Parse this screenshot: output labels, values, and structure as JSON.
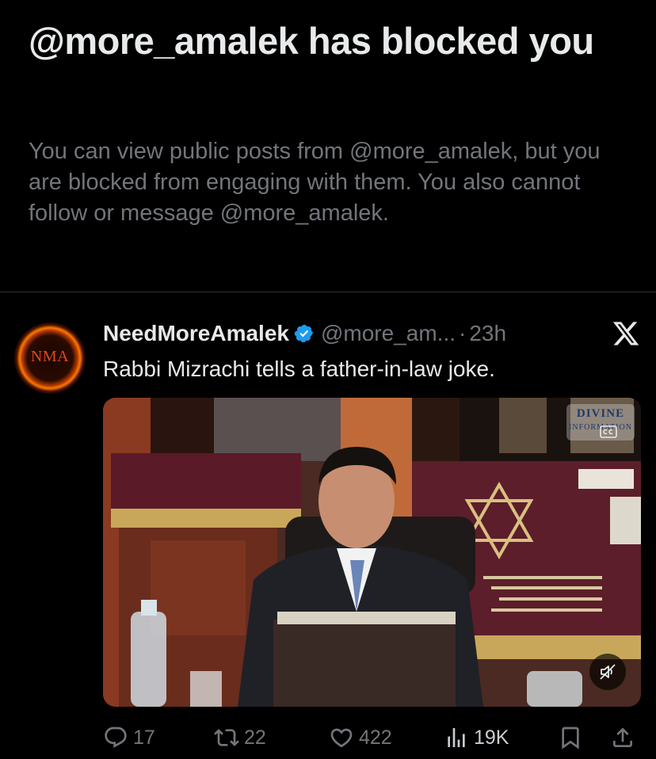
{
  "block_notice": {
    "title": "@more_amalek has blocked you",
    "description": "You can view public posts from @more_amalek, but you are blocked from engaging with them. You also cannot follow or message @more_amalek."
  },
  "tweet": {
    "avatar_text": "NMA",
    "author_name": "NeedMoreAmalek",
    "verified": true,
    "handle": "@more_am...",
    "separator": "·",
    "time": "23h",
    "text": "Rabbi Mizrachi tells a father-in-law joke.",
    "media": {
      "watermark_title": "DIVINE",
      "watermark_sub": "INFORMATION",
      "muted": true
    },
    "actions": {
      "replies": "17",
      "reposts": "22",
      "likes": "422",
      "views": "19K"
    }
  },
  "colors": {
    "background": "#000000",
    "primary_text": "#e7e9ea",
    "secondary_text": "#71767b",
    "verified_blue": "#1d9bf0",
    "divider": "#2f3336"
  }
}
